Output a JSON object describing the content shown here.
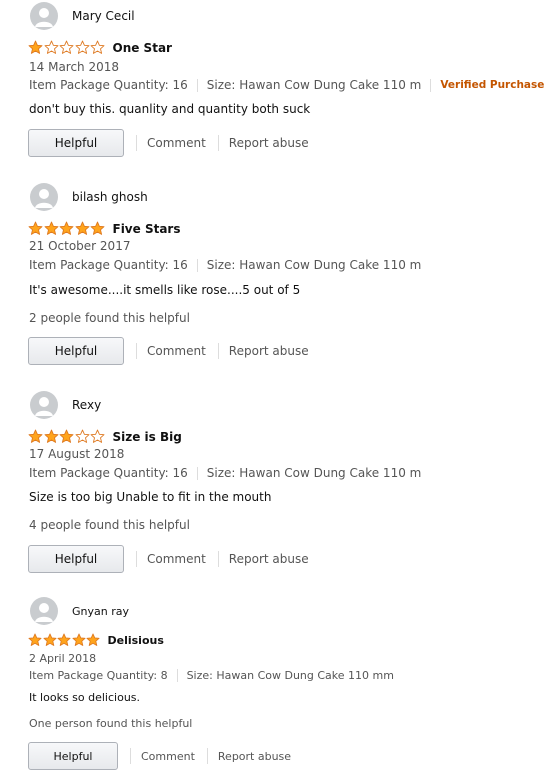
{
  "reviews": [
    {
      "author": "Mary Cecil",
      "rating": 1,
      "title": "One Star",
      "date": "14 March 2018",
      "quantity": "Item Package Quantity: 16",
      "size": "Size: Hawan Cow Dung Cake 110 m",
      "verified": "Verified Purchase",
      "text": "don't buy this. quanlity and quantity both suck",
      "helpful_count": "",
      "helpful_label": "Helpful",
      "comment_label": "Comment",
      "report_label": "Report abuse"
    },
    {
      "author": "bilash ghosh",
      "rating": 5,
      "title": "Five Stars",
      "date": "21 October 2017",
      "quantity": "Item Package Quantity: 16",
      "size": "Size: Hawan Cow Dung Cake 110 m",
      "verified": "",
      "text": "It's awesome....it smells like rose....5 out of 5",
      "helpful_count": "2 people found this helpful",
      "helpful_label": "Helpful",
      "comment_label": "Comment",
      "report_label": "Report abuse"
    },
    {
      "author": "Rexy",
      "rating": 3,
      "title": "Size is Big",
      "date": "17 August 2018",
      "quantity": "Item Package Quantity: 16",
      "size": "Size: Hawan Cow Dung Cake 110 m",
      "verified": "",
      "text": "Size is too big Unable to fit in the mouth",
      "helpful_count": "4 people found this helpful",
      "helpful_label": "Helpful",
      "comment_label": "Comment",
      "report_label": "Report abuse"
    },
    {
      "author": "Gnyan ray",
      "rating": 5,
      "title": "Delisious",
      "date": "2 April 2018",
      "quantity": "Item Package Quantity: 8",
      "size": "Size: Hawan Cow Dung Cake 110 mm",
      "verified": "",
      "text": "It looks so delicious.",
      "helpful_count": "One person found this helpful",
      "helpful_label": "Helpful",
      "comment_label": "Comment",
      "report_label": "Report abuse"
    }
  ],
  "colors": {
    "star_filled": "#ffa41c",
    "star_outline": "#de7921",
    "verified": "#c45500"
  }
}
